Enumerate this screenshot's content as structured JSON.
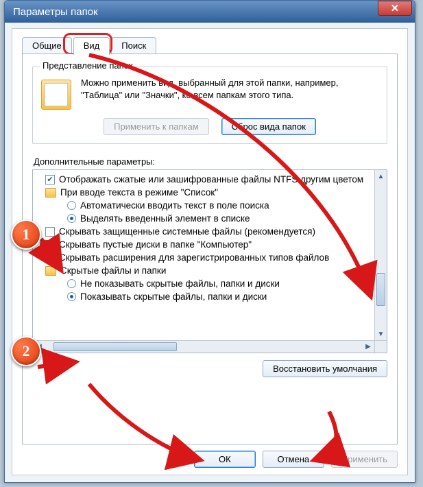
{
  "window": {
    "title": "Параметры папок"
  },
  "tabs": {
    "general": "Общие",
    "view": "Вид",
    "search": "Поиск"
  },
  "folderViews": {
    "legend": "Представление папок",
    "text": "Можно применить вид, выбранный для этой папки, например, \"Таблица\" или \"Значки\", ко всем папкам этого типа.",
    "apply": "Применить к папкам",
    "reset": "Сброс вида папок"
  },
  "advanced": {
    "label": "Дополнительные параметры:",
    "items": [
      {
        "kind": "check",
        "checked": true,
        "text": "Отображать сжатые или зашифрованные файлы NTFS другим цветом"
      },
      {
        "kind": "group",
        "text": "При вводе текста в режиме \"Список\""
      },
      {
        "kind": "radio",
        "checked": false,
        "child": true,
        "text": "Автоматически вводить текст в поле поиска"
      },
      {
        "kind": "radio",
        "checked": true,
        "child": true,
        "text": "Выделять введенный элемент в списке"
      },
      {
        "kind": "check",
        "checked": false,
        "text": "Скрывать защищенные системные файлы (рекомендуется)"
      },
      {
        "kind": "check",
        "checked": true,
        "text": "Скрывать пустые диски в папке \"Компьютер\""
      },
      {
        "kind": "check",
        "checked": false,
        "text": "Скрывать расширения для зарегистрированных типов файлов"
      },
      {
        "kind": "group",
        "text": "Скрытые файлы и папки"
      },
      {
        "kind": "radio",
        "checked": false,
        "child": true,
        "text": "Не показывать скрытые файлы, папки и диски"
      },
      {
        "kind": "radio",
        "checked": true,
        "child": true,
        "text": "Показывать скрытые файлы, папки и диски"
      }
    ],
    "restore": "Восстановить умолчания"
  },
  "buttons": {
    "ok": "ОК",
    "cancel": "Отмена",
    "apply": "Применить"
  },
  "callouts": {
    "one": "1",
    "two": "2"
  }
}
